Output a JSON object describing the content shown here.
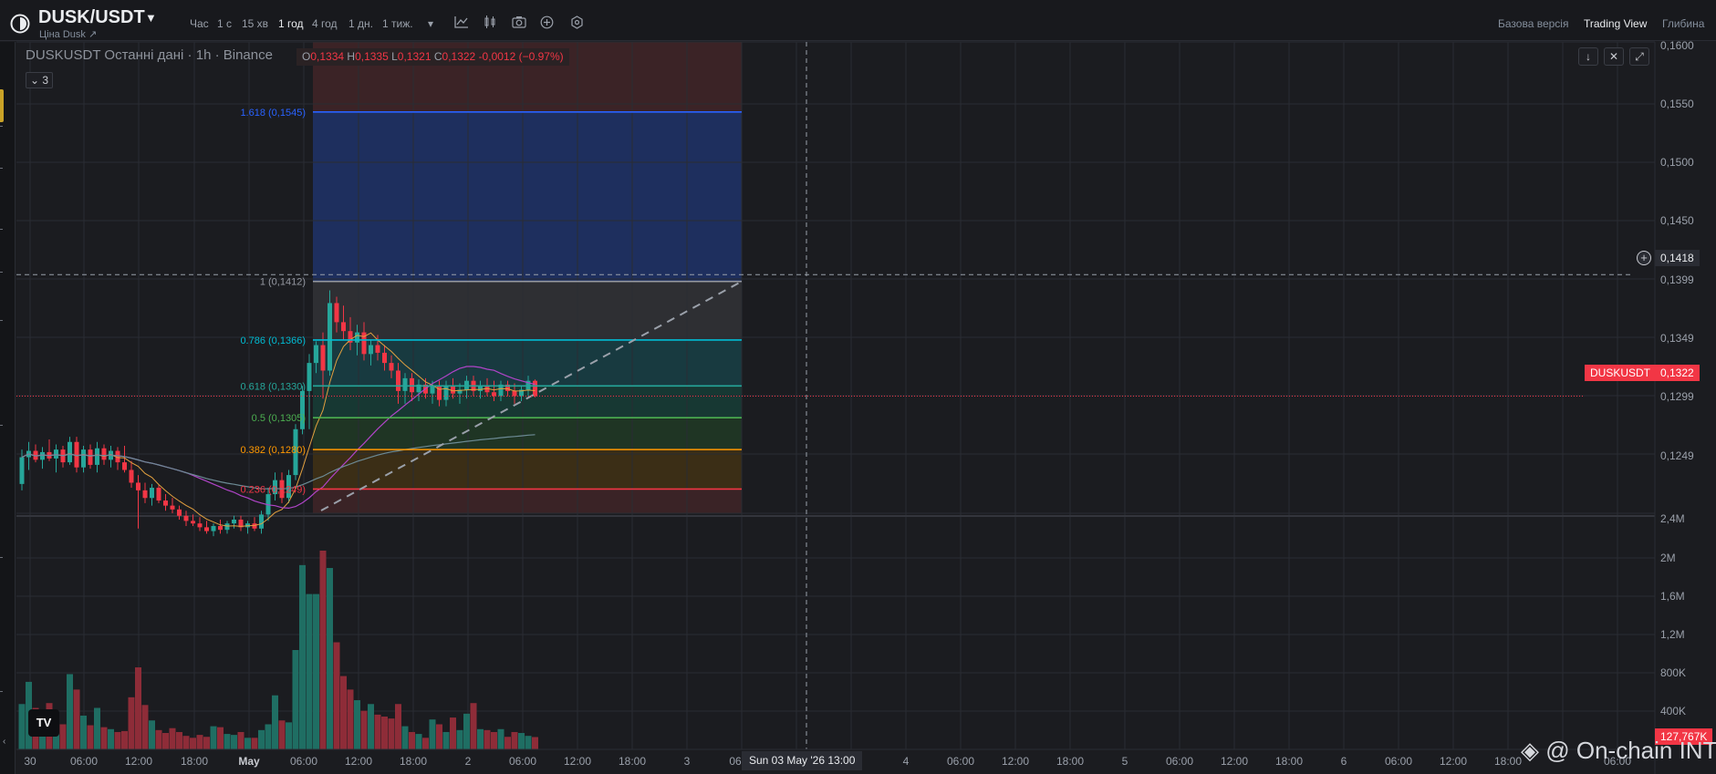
{
  "header": {
    "pair": "DUSK/USDT",
    "subtitle": "Ціна Dusk ↗",
    "timeframes": [
      "Час",
      "1 с",
      "15 хв",
      "1 год",
      "4 год",
      "1 дн.",
      "1 тиж."
    ],
    "active_timeframe": "1 год",
    "views": [
      "Базова версія",
      "Trading View",
      "Глибина"
    ],
    "active_view": "Trading View"
  },
  "legend": {
    "title": "DUSKUSDT Останні дані · 1h · Binance",
    "o_label": "O",
    "o": "0,1334",
    "h_label": "H",
    "h": "0,1335",
    "l_label": "L",
    "l": "0,1321",
    "c_label": "C",
    "c": "0,1322",
    "change": "-0,0012 (−0.97%)",
    "indicator_count": "3"
  },
  "controls": {
    "scroll_down": "↓",
    "collapse": "✕",
    "fullscreen": "⤢"
  },
  "price_axis": {
    "labels": [
      "0,1600",
      "0,1550",
      "0,1500",
      "0,1450",
      "0,1399",
      "0,1349",
      "0,1299",
      "0,1249"
    ],
    "volume_labels": [
      "2,4M",
      "2M",
      "1,6M",
      "1,2M",
      "800K",
      "400K"
    ],
    "crosshair_price": "0,1418",
    "last_price": "0,1322",
    "last_symbol": "DUSKUSDT",
    "last_volume": "127,767K"
  },
  "time_axis": {
    "labels": [
      "30",
      "06:00",
      "12:00",
      "18:00",
      "May",
      "06:00",
      "12:00",
      "18:00",
      "2",
      "06:00",
      "12:00",
      "18:00",
      "3",
      "06",
      "4",
      "06:00",
      "12:00",
      "18:00",
      "5",
      "06:00",
      "12:00",
      "18:00",
      "6",
      "06:00",
      "12:00",
      "18:00",
      "06:00"
    ],
    "crosshair_date": "Sun 03 May '26   13:00"
  },
  "watermark": "@ On-chain INT",
  "tv_logo": "TV",
  "chart_data": {
    "type": "candlestick",
    "symbol": "DUSKUSDT",
    "interval": "1h",
    "exchange": "Binance",
    "ylim": [
      0.123,
      0.16
    ],
    "volume_ylim": [
      0,
      2400000
    ],
    "candles": [
      {
        "o": 0.1253,
        "h": 0.128,
        "l": 0.1248,
        "c": 0.1274,
        "v": 470000
      },
      {
        "o": 0.1274,
        "h": 0.1286,
        "l": 0.1264,
        "c": 0.1279,
        "v": 700000
      },
      {
        "o": 0.1279,
        "h": 0.1284,
        "l": 0.127,
        "c": 0.1272,
        "v": 430000
      },
      {
        "o": 0.1272,
        "h": 0.1282,
        "l": 0.1265,
        "c": 0.1278,
        "v": 360000
      },
      {
        "o": 0.1278,
        "h": 0.1288,
        "l": 0.1271,
        "c": 0.1273,
        "v": 480000
      },
      {
        "o": 0.1273,
        "h": 0.1284,
        "l": 0.1262,
        "c": 0.128,
        "v": 300000
      },
      {
        "o": 0.128,
        "h": 0.1283,
        "l": 0.1266,
        "c": 0.127,
        "v": 260000
      },
      {
        "o": 0.127,
        "h": 0.129,
        "l": 0.1268,
        "c": 0.1286,
        "v": 780000
      },
      {
        "o": 0.1286,
        "h": 0.129,
        "l": 0.1262,
        "c": 0.1266,
        "v": 620000
      },
      {
        "o": 0.1266,
        "h": 0.1283,
        "l": 0.1262,
        "c": 0.128,
        "v": 350000
      },
      {
        "o": 0.128,
        "h": 0.1284,
        "l": 0.1265,
        "c": 0.1268,
        "v": 250000
      },
      {
        "o": 0.1268,
        "h": 0.1286,
        "l": 0.1262,
        "c": 0.1281,
        "v": 430000
      },
      {
        "o": 0.1281,
        "h": 0.1284,
        "l": 0.1268,
        "c": 0.1272,
        "v": 230000
      },
      {
        "o": 0.1272,
        "h": 0.1283,
        "l": 0.1266,
        "c": 0.1279,
        "v": 210000
      },
      {
        "o": 0.1279,
        "h": 0.1282,
        "l": 0.1264,
        "c": 0.127,
        "v": 180000
      },
      {
        "o": 0.127,
        "h": 0.1283,
        "l": 0.1262,
        "c": 0.1264,
        "v": 190000
      },
      {
        "o": 0.1264,
        "h": 0.1271,
        "l": 0.125,
        "c": 0.1254,
        "v": 540000
      },
      {
        "o": 0.1254,
        "h": 0.126,
        "l": 0.1218,
        "c": 0.1248,
        "v": 850000
      },
      {
        "o": 0.1248,
        "h": 0.1254,
        "l": 0.1238,
        "c": 0.1242,
        "v": 460000
      },
      {
        "o": 0.1242,
        "h": 0.1253,
        "l": 0.1236,
        "c": 0.125,
        "v": 300000
      },
      {
        "o": 0.125,
        "h": 0.1252,
        "l": 0.1238,
        "c": 0.124,
        "v": 200000
      },
      {
        "o": 0.124,
        "h": 0.1245,
        "l": 0.1232,
        "c": 0.1236,
        "v": 170000
      },
      {
        "o": 0.1236,
        "h": 0.1242,
        "l": 0.123,
        "c": 0.1233,
        "v": 220000
      },
      {
        "o": 0.1233,
        "h": 0.1236,
        "l": 0.1225,
        "c": 0.1228,
        "v": 180000
      },
      {
        "o": 0.1228,
        "h": 0.1232,
        "l": 0.122,
        "c": 0.1224,
        "v": 140000
      },
      {
        "o": 0.1224,
        "h": 0.1229,
        "l": 0.122,
        "c": 0.1222,
        "v": 120000
      },
      {
        "o": 0.1222,
        "h": 0.1227,
        "l": 0.1216,
        "c": 0.1219,
        "v": 150000
      },
      {
        "o": 0.1219,
        "h": 0.1224,
        "l": 0.1214,
        "c": 0.1216,
        "v": 130000
      },
      {
        "o": 0.1216,
        "h": 0.1222,
        "l": 0.1212,
        "c": 0.122,
        "v": 240000
      },
      {
        "o": 0.122,
        "h": 0.1225,
        "l": 0.1214,
        "c": 0.1217,
        "v": 230000
      },
      {
        "o": 0.1217,
        "h": 0.1224,
        "l": 0.1214,
        "c": 0.1222,
        "v": 160000
      },
      {
        "o": 0.1222,
        "h": 0.1228,
        "l": 0.1218,
        "c": 0.1225,
        "v": 150000
      },
      {
        "o": 0.1225,
        "h": 0.1228,
        "l": 0.1216,
        "c": 0.1219,
        "v": 180000
      },
      {
        "o": 0.1219,
        "h": 0.1224,
        "l": 0.1214,
        "c": 0.1222,
        "v": 120000
      },
      {
        "o": 0.1222,
        "h": 0.1227,
        "l": 0.1216,
        "c": 0.1218,
        "v": 120000
      },
      {
        "o": 0.1218,
        "h": 0.1232,
        "l": 0.1214,
        "c": 0.1229,
        "v": 200000
      },
      {
        "o": 0.1229,
        "h": 0.125,
        "l": 0.1224,
        "c": 0.1245,
        "v": 260000
      },
      {
        "o": 0.1245,
        "h": 0.1262,
        "l": 0.124,
        "c": 0.1256,
        "v": 560000
      },
      {
        "o": 0.1256,
        "h": 0.1262,
        "l": 0.1238,
        "c": 0.1242,
        "v": 300000
      },
      {
        "o": 0.1242,
        "h": 0.1264,
        "l": 0.1238,
        "c": 0.126,
        "v": 280000
      },
      {
        "o": 0.126,
        "h": 0.13,
        "l": 0.1256,
        "c": 0.1296,
        "v": 1030000
      },
      {
        "o": 0.1296,
        "h": 0.133,
        "l": 0.1292,
        "c": 0.1326,
        "v": 1910000
      },
      {
        "o": 0.1326,
        "h": 0.1355,
        "l": 0.1296,
        "c": 0.1348,
        "v": 1610000
      },
      {
        "o": 0.1348,
        "h": 0.1365,
        "l": 0.134,
        "c": 0.1362,
        "v": 1610000
      },
      {
        "o": 0.1362,
        "h": 0.1372,
        "l": 0.132,
        "c": 0.1342,
        "v": 2060000
      },
      {
        "o": 0.1342,
        "h": 0.1405,
        "l": 0.1338,
        "c": 0.1395,
        "v": 1880000
      },
      {
        "o": 0.1395,
        "h": 0.14,
        "l": 0.1372,
        "c": 0.138,
        "v": 1110000
      },
      {
        "o": 0.138,
        "h": 0.1393,
        "l": 0.1366,
        "c": 0.1373,
        "v": 760000
      },
      {
        "o": 0.1373,
        "h": 0.1384,
        "l": 0.1358,
        "c": 0.1364,
        "v": 620000
      },
      {
        "o": 0.1364,
        "h": 0.1378,
        "l": 0.1354,
        "c": 0.1372,
        "v": 510000
      },
      {
        "o": 0.1372,
        "h": 0.138,
        "l": 0.135,
        "c": 0.1355,
        "v": 400000
      },
      {
        "o": 0.1355,
        "h": 0.1366,
        "l": 0.1346,
        "c": 0.1362,
        "v": 470000
      },
      {
        "o": 0.1362,
        "h": 0.137,
        "l": 0.135,
        "c": 0.1356,
        "v": 360000
      },
      {
        "o": 0.1356,
        "h": 0.1362,
        "l": 0.1342,
        "c": 0.1348,
        "v": 340000
      },
      {
        "o": 0.1348,
        "h": 0.1354,
        "l": 0.1336,
        "c": 0.1342,
        "v": 320000
      },
      {
        "o": 0.1342,
        "h": 0.1348,
        "l": 0.1316,
        "c": 0.1326,
        "v": 470000
      },
      {
        "o": 0.1326,
        "h": 0.134,
        "l": 0.1316,
        "c": 0.1336,
        "v": 240000
      },
      {
        "o": 0.1336,
        "h": 0.134,
        "l": 0.1318,
        "c": 0.1325,
        "v": 180000
      },
      {
        "o": 0.1325,
        "h": 0.1335,
        "l": 0.1318,
        "c": 0.1331,
        "v": 160000
      },
      {
        "o": 0.1331,
        "h": 0.1336,
        "l": 0.132,
        "c": 0.1324,
        "v": 120000
      },
      {
        "o": 0.1324,
        "h": 0.1334,
        "l": 0.1316,
        "c": 0.133,
        "v": 310000
      },
      {
        "o": 0.133,
        "h": 0.1334,
        "l": 0.1314,
        "c": 0.1319,
        "v": 260000
      },
      {
        "o": 0.1319,
        "h": 0.1334,
        "l": 0.1314,
        "c": 0.133,
        "v": 180000
      },
      {
        "o": 0.133,
        "h": 0.1336,
        "l": 0.132,
        "c": 0.1324,
        "v": 330000
      },
      {
        "o": 0.1324,
        "h": 0.1332,
        "l": 0.1316,
        "c": 0.1327,
        "v": 200000
      },
      {
        "o": 0.1327,
        "h": 0.1338,
        "l": 0.132,
        "c": 0.1334,
        "v": 370000
      },
      {
        "o": 0.1334,
        "h": 0.1338,
        "l": 0.1322,
        "c": 0.1326,
        "v": 480000
      },
      {
        "o": 0.1326,
        "h": 0.1334,
        "l": 0.132,
        "c": 0.133,
        "v": 210000
      },
      {
        "o": 0.133,
        "h": 0.1336,
        "l": 0.1322,
        "c": 0.1325,
        "v": 200000
      },
      {
        "o": 0.1325,
        "h": 0.1334,
        "l": 0.1318,
        "c": 0.1322,
        "v": 180000
      },
      {
        "o": 0.1322,
        "h": 0.1334,
        "l": 0.1318,
        "c": 0.1331,
        "v": 210000
      },
      {
        "o": 0.1331,
        "h": 0.1334,
        "l": 0.1322,
        "c": 0.1326,
        "v": 130000
      },
      {
        "o": 0.1326,
        "h": 0.1332,
        "l": 0.1316,
        "c": 0.1322,
        "v": 180000
      },
      {
        "o": 0.1322,
        "h": 0.133,
        "l": 0.1318,
        "c": 0.1327,
        "v": 170000
      },
      {
        "o": 0.1327,
        "h": 0.1338,
        "l": 0.1322,
        "c": 0.1334,
        "v": 140000
      },
      {
        "o": 0.1334,
        "h": 0.1335,
        "l": 0.1321,
        "c": 0.1322,
        "v": 127767
      }
    ],
    "fibonacci": {
      "levels": [
        {
          "ratio": 1.618,
          "label": "1.618 (0,1545)",
          "price": 0.1545,
          "color": "#2962ff",
          "fill": "#1e2f5e"
        },
        {
          "ratio": 1,
          "label": "1 (0,1412)",
          "price": 0.1412,
          "color": "#9598a1",
          "fill": "#2e2f33"
        },
        {
          "ratio": 0.786,
          "label": "0.786 (0,1366)",
          "price": 0.1366,
          "color": "#00bcd4",
          "fill": "#183a40"
        },
        {
          "ratio": 0.618,
          "label": "0.618 (0,1330)",
          "price": 0.133,
          "color": "#26a69a",
          "fill": "#173833"
        },
        {
          "ratio": 0.5,
          "label": "0.5 (0,1305)",
          "price": 0.1305,
          "color": "#4caf50",
          "fill": "#1f3524"
        },
        {
          "ratio": 0.382,
          "label": "0.382 (0,1280)",
          "price": 0.128,
          "color": "#ff9800",
          "fill": "#3b2e16"
        },
        {
          "ratio": 0.236,
          "label": "0.236 (0,1249)",
          "price": 0.1249,
          "color": "#f23645",
          "fill": "#3a2326"
        }
      ],
      "top_price": 0.16,
      "bottom_price": 0.123,
      "outer_fill": "#3b2326"
    },
    "colors": {
      "up": "#26a69a",
      "down": "#f23645",
      "up_volume": "#1f6e63",
      "down_volume": "#8e2c38",
      "grid": "#2a2c33",
      "ma_fast": "#e2a03f",
      "ma_mid": "#b044c8",
      "ma_slow": "#6c8a94"
    }
  }
}
